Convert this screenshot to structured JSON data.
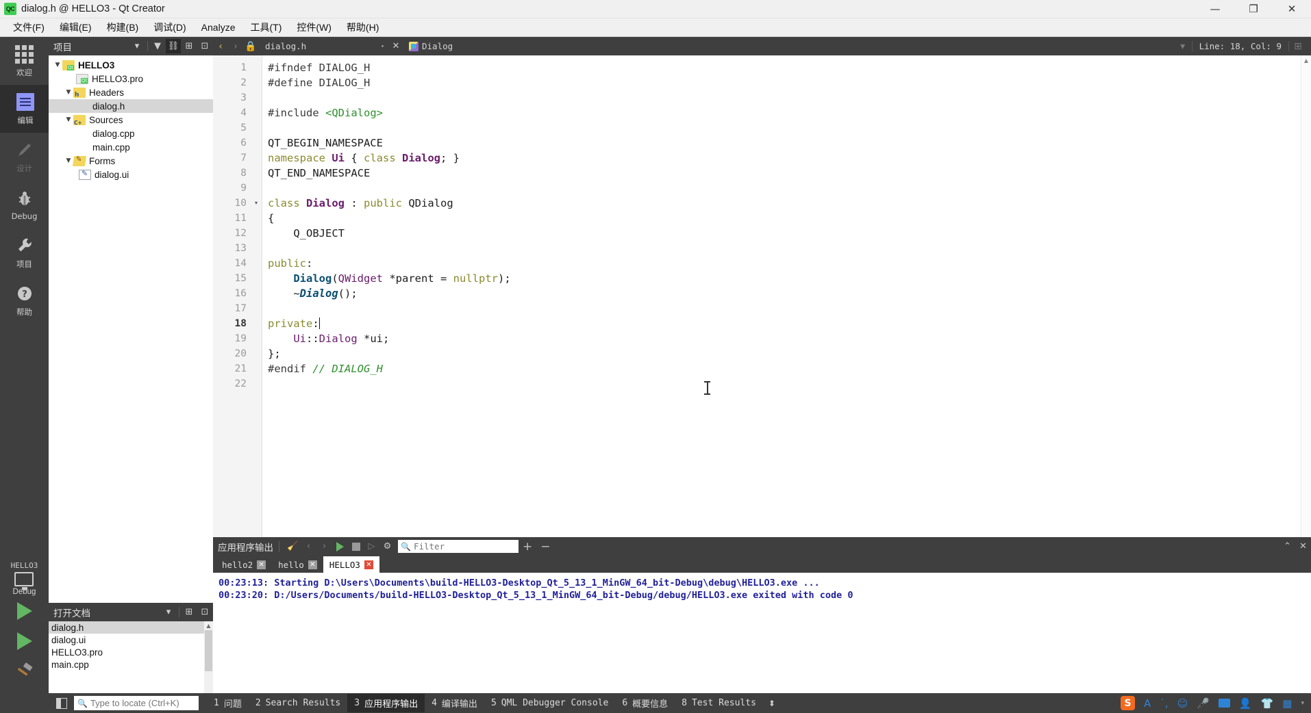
{
  "window": {
    "title": "dialog.h @ HELLO3 - Qt Creator",
    "logo_text": "QC",
    "minimize": "—",
    "maximize": "❐",
    "close": "✕"
  },
  "menubar": [
    {
      "label": "文件(F)"
    },
    {
      "label": "编辑(E)"
    },
    {
      "label": "构建(B)"
    },
    {
      "label": "调试(D)"
    },
    {
      "label": "Analyze"
    },
    {
      "label": "工具(T)"
    },
    {
      "label": "控件(W)"
    },
    {
      "label": "帮助(H)"
    }
  ],
  "modebar": {
    "items": [
      {
        "label": "欢迎",
        "icon": "grid-icon",
        "state": "normal"
      },
      {
        "label": "编辑",
        "icon": "edit-icon",
        "state": "active"
      },
      {
        "label": "设计",
        "icon": "pencil-icon",
        "state": "disabled"
      },
      {
        "label": "Debug",
        "icon": "bug-icon",
        "state": "normal"
      },
      {
        "label": "项目",
        "icon": "wrench-icon",
        "state": "normal"
      },
      {
        "label": "帮助",
        "icon": "question-icon",
        "state": "normal"
      }
    ],
    "kit_name": "HELLO3",
    "kit_config": "Debug",
    "run_label": "run-icon",
    "debug_label": "run-debug-icon",
    "build_label": "build-hammer-icon"
  },
  "project_panel": {
    "title": "项目",
    "icons": [
      "chevron-down-icon",
      "filter-icon",
      "link-icon",
      "split-icon",
      "collapse-icon"
    ],
    "tree": [
      {
        "label": "HELLO3",
        "indent": 0,
        "icon": "qt-project-icon",
        "twisty": "▼",
        "bold": true,
        "selected": false
      },
      {
        "label": "HELLO3.pro",
        "indent": 1,
        "icon": "qt-pro-file-icon",
        "twisty": "",
        "bold": false,
        "selected": false
      },
      {
        "label": "Headers",
        "indent": 1,
        "icon": "headers-folder-icon",
        "twisty": "▼",
        "bold": false,
        "selected": false
      },
      {
        "label": "dialog.h",
        "indent": 2,
        "icon": "none",
        "twisty": "",
        "bold": false,
        "selected": true
      },
      {
        "label": "Sources",
        "indent": 1,
        "icon": "sources-folder-icon",
        "twisty": "▼",
        "bold": false,
        "selected": false
      },
      {
        "label": "dialog.cpp",
        "indent": 2,
        "icon": "none",
        "twisty": "",
        "bold": false,
        "selected": false
      },
      {
        "label": "main.cpp",
        "indent": 2,
        "icon": "none",
        "twisty": "",
        "bold": false,
        "selected": false
      },
      {
        "label": "Forms",
        "indent": 1,
        "icon": "forms-folder-icon",
        "twisty": "▼",
        "bold": false,
        "selected": false
      },
      {
        "label": "dialog.ui",
        "indent": 2,
        "icon": "ui-file-icon",
        "twisty": "",
        "bold": false,
        "selected": false
      }
    ]
  },
  "open_documents": {
    "title": "打开文档",
    "icons": [
      "chevron-down-icon",
      "split-icon",
      "collapse-icon"
    ],
    "items": [
      {
        "label": "dialog.h",
        "selected": true
      },
      {
        "label": "dialog.ui",
        "selected": false
      },
      {
        "label": "HELLO3.pro",
        "selected": false
      },
      {
        "label": "main.cpp",
        "selected": false
      }
    ]
  },
  "editor_toolbar": {
    "back": "‹",
    "forward": "›",
    "lock": "lock-icon",
    "file_combo": "dialog.h",
    "close_label": "✕",
    "symbol": "Dialog",
    "line_col": "Line: 18, Col: 9",
    "split_icon": "split-icon"
  },
  "editor": {
    "current_line": 18,
    "lines": [
      {
        "n": 1,
        "fold": "",
        "tokens": [
          {
            "t": "#ifndef DIALOG_H",
            "c": "k-pp"
          }
        ]
      },
      {
        "n": 2,
        "fold": "",
        "tokens": [
          {
            "t": "#define DIALOG_H",
            "c": "k-pp"
          }
        ]
      },
      {
        "n": 3,
        "fold": "",
        "tokens": []
      },
      {
        "n": 4,
        "fold": "",
        "tokens": [
          {
            "t": "#include ",
            "c": "k-pp"
          },
          {
            "t": "<QDialog>",
            "c": "k-str"
          }
        ]
      },
      {
        "n": 5,
        "fold": "",
        "tokens": []
      },
      {
        "n": 6,
        "fold": "",
        "tokens": [
          {
            "t": "QT_BEGIN_NAMESPACE",
            "c": "k-plain"
          }
        ]
      },
      {
        "n": 7,
        "fold": "",
        "tokens": [
          {
            "t": "namespace ",
            "c": "k-key"
          },
          {
            "t": "Ui",
            "c": "k-type"
          },
          {
            "t": " { ",
            "c": "k-plain"
          },
          {
            "t": "class ",
            "c": "k-key"
          },
          {
            "t": "Dialog",
            "c": "k-type"
          },
          {
            "t": "; }",
            "c": "k-plain"
          }
        ]
      },
      {
        "n": 8,
        "fold": "",
        "tokens": [
          {
            "t": "QT_END_NAMESPACE",
            "c": "k-plain"
          }
        ]
      },
      {
        "n": 9,
        "fold": "",
        "tokens": []
      },
      {
        "n": 10,
        "fold": "▾",
        "tokens": [
          {
            "t": "class ",
            "c": "k-key"
          },
          {
            "t": "Dialog",
            "c": "k-type"
          },
          {
            "t": " : ",
            "c": "k-plain"
          },
          {
            "t": "public ",
            "c": "k-key"
          },
          {
            "t": "QDialog",
            "c": "k-plain"
          }
        ]
      },
      {
        "n": 11,
        "fold": "",
        "tokens": [
          {
            "t": "{",
            "c": "k-plain"
          }
        ]
      },
      {
        "n": 12,
        "fold": "",
        "tokens": [
          {
            "t": "    Q_OBJECT",
            "c": "k-plain"
          }
        ]
      },
      {
        "n": 13,
        "fold": "",
        "tokens": []
      },
      {
        "n": 14,
        "fold": "",
        "tokens": [
          {
            "t": "public",
            "c": "k-key"
          },
          {
            "t": ":",
            "c": "k-plain"
          }
        ]
      },
      {
        "n": 15,
        "fold": "",
        "tokens": [
          {
            "t": "    ",
            "c": "k-plain"
          },
          {
            "t": "Dialog",
            "c": "k-fn"
          },
          {
            "t": "(",
            "c": "k-plain"
          },
          {
            "t": "QWidget",
            "c": "k-typep"
          },
          {
            "t": " *parent = ",
            "c": "k-plain"
          },
          {
            "t": "nullptr",
            "c": "k-key"
          },
          {
            "t": ");",
            "c": "k-plain"
          }
        ]
      },
      {
        "n": 16,
        "fold": "",
        "tokens": [
          {
            "t": "    ~",
            "c": "k-plain"
          },
          {
            "t": "Dialog",
            "c": "k-fni"
          },
          {
            "t": "();",
            "c": "k-plain"
          }
        ]
      },
      {
        "n": 17,
        "fold": "",
        "tokens": []
      },
      {
        "n": 18,
        "fold": "",
        "tokens": [
          {
            "t": "private",
            "c": "k-key"
          },
          {
            "t": ":",
            "c": "k-plain"
          }
        ],
        "caret": true
      },
      {
        "n": 19,
        "fold": "",
        "tokens": [
          {
            "t": "    ",
            "c": "k-plain"
          },
          {
            "t": "Ui",
            "c": "k-typep"
          },
          {
            "t": "::",
            "c": "k-plain"
          },
          {
            "t": "Dialog",
            "c": "k-typep"
          },
          {
            "t": " *ui;",
            "c": "k-plain"
          }
        ]
      },
      {
        "n": 20,
        "fold": "",
        "tokens": [
          {
            "t": "};",
            "c": "k-plain"
          }
        ]
      },
      {
        "n": 21,
        "fold": "",
        "tokens": [
          {
            "t": "#endif ",
            "c": "k-pp"
          },
          {
            "t": "// DIALOG_H",
            "c": "k-cmt"
          }
        ]
      },
      {
        "n": 22,
        "fold": "",
        "tokens": []
      }
    ]
  },
  "output_pane": {
    "title": "应用程序输出",
    "toolbar_icons": [
      "clear-icon",
      "prev-icon",
      "next-icon",
      "run-icon",
      "stop-icon",
      "attach-icon",
      "gear-icon"
    ],
    "filter_placeholder": "Filter",
    "filter_value": "",
    "plus_label": "+",
    "minus_label": "−",
    "collapse_icon": "chevron-up-icon",
    "close_icon": "close-icon",
    "tabs": [
      {
        "label": "hello2",
        "active": false
      },
      {
        "label": "hello",
        "active": false
      },
      {
        "label": "HELLO3",
        "active": true
      }
    ],
    "lines": [
      "00:23:13: Starting D:\\Users\\Documents\\build-HELLO3-Desktop_Qt_5_13_1_MinGW_64_bit-Debug\\debug\\HELLO3.exe ...",
      "00:23:20: D:/Users/Documents/build-HELLO3-Desktop_Qt_5_13_1_MinGW_64_bit-Debug/debug/HELLO3.exe exited with code 0"
    ]
  },
  "statusbar": {
    "toggle_sidebar_icon": "toggle-sidebar-icon",
    "locate_placeholder": "Type to locate (Ctrl+K)",
    "locate_value": "",
    "search_icon": "search-icon",
    "tabs": [
      {
        "num": "1",
        "label": "问题",
        "active": false
      },
      {
        "num": "2",
        "label": "Search Results",
        "active": false
      },
      {
        "num": "3",
        "label": "应用程序输出",
        "active": true
      },
      {
        "num": "4",
        "label": "编译输出",
        "active": false
      },
      {
        "num": "5",
        "label": "QML Debugger Console",
        "active": false
      },
      {
        "num": "6",
        "label": "概要信息",
        "active": false
      },
      {
        "num": "8",
        "label": "Test Results",
        "active": false
      }
    ],
    "arrows": "⬍",
    "ime": {
      "logo": "sogou-icon",
      "items": [
        "A",
        "punctuation-icon",
        "emoji-icon",
        "microphone-icon",
        "keyboard-icon",
        "user-icon",
        "skin-icon",
        "apps-icon"
      ]
    }
  },
  "colors": {
    "dark_chrome": "#3f3f3f",
    "window_chrome": "#f0f0f0",
    "accent_green": "#41cd52",
    "selection": "#d6d6d6",
    "output_text": "#21219a"
  }
}
